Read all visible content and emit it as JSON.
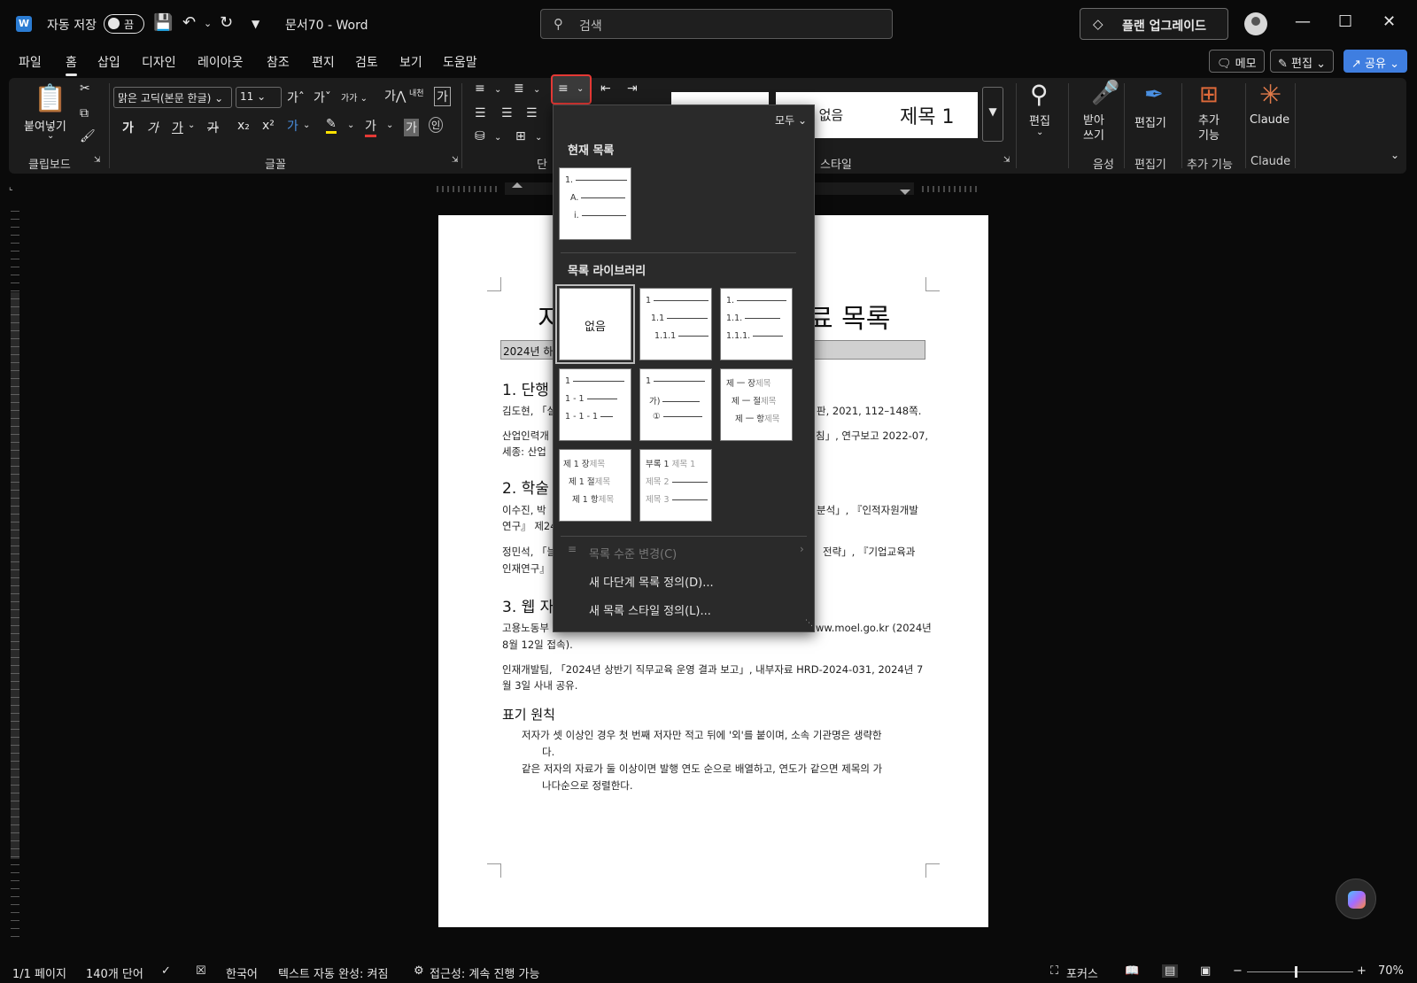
{
  "titlebar": {
    "autosave_label": "자동 저장",
    "autosave_state": "끔",
    "doc_title": "문서70  -  Word",
    "search_placeholder": "검색",
    "upgrade_label": "플랜 업그레이드"
  },
  "tabs": [
    "파일",
    "홈",
    "삽입",
    "디자인",
    "레이아웃",
    "참조",
    "편지",
    "검토",
    "보기",
    "도움말"
  ],
  "active_tab": "홈",
  "top_right": {
    "memo": "메모",
    "edit": "편집",
    "share": "공유"
  },
  "ribbon": {
    "paste_label": "붙여넣기",
    "clipboard_group": "클립보드",
    "font_name": "맑은 고딕(본문 한글)",
    "font_size": "11",
    "font_group": "글꼴",
    "paragraph_group_partial": "단",
    "styles_group_partial": "스타일",
    "style_nospacing_partial": "격 없음",
    "style_heading1": "제목 1",
    "editing_label": "편집",
    "dictate_label": "받아\n쓰기",
    "voice_group": "음성",
    "editor_label": "편집기",
    "editor_group": "편집기",
    "addins_label": "추가\n기능",
    "addins_group": "추가 기능",
    "claude_label": "Claude",
    "claude_group": "Claude",
    "font_buttons": [
      "가",
      "가",
      "가",
      "가",
      "x₂",
      "x²"
    ]
  },
  "multilevel_dropdown": {
    "filter_label": "모두",
    "current_list_heading": "현재 목록",
    "current_list_tile": [
      "1.",
      "A.",
      "i."
    ],
    "library_heading": "목록 라이브러리",
    "none_label": "없음",
    "tiles": [
      {
        "lines": [
          "1",
          "1.1",
          "1.1.1"
        ]
      },
      {
        "lines": [
          "1.",
          "1.1.",
          "1.1.1."
        ]
      },
      {
        "lines": [
          "1",
          "1 - 1",
          "1 - 1 - 1"
        ]
      },
      {
        "lines": [
          "1",
          "가)",
          "①"
        ]
      },
      {
        "lines": [
          "제 一 장",
          "제 一 절",
          "제 一 항"
        ],
        "suffix": "제목"
      },
      {
        "lines": [
          "제 1 장",
          "제 1 절",
          "제 1 항"
        ],
        "suffix": "제목"
      },
      {
        "lines": [
          "부록 1",
          "제목 2",
          "제목 3"
        ],
        "suffix": "제목 1"
      }
    ],
    "change_level": "목록 수준 변경(C)",
    "define_multilevel": "새 다단계 목록 정의(D)...",
    "define_style": "새 목록 스타일 정의(L)..."
  },
  "document": {
    "title_left": "지",
    "title_right": "료 목록",
    "subtitle_left": "2024년 하",
    "h1": "1. 단행",
    "p1": "김도현, 「실",
    "p1_end": "판, 2021, 112–148쪽.",
    "p2a": "산업인력개",
    "p2a_end": "침」, 연구보고 2022-07,",
    "p2b": "세종: 산업",
    "h2": "2. 학술",
    "p3a": "이수진, 박",
    "p3a_end": "분석」, 『인적자원개발",
    "p3b": "연구』 제24",
    "p4a": "정민석, 「늘",
    "p4a_end": "전략」, 『기업교육과",
    "p4b": "인재연구』",
    "h3": "3. 웹 자",
    "p5a": "고용노동부",
    "p5a_end": "ww.moel.go.kr (2024년",
    "p5b": "8월 12일 접속).",
    "p6a": "인재개발팀, 「2024년 상반기 직무교육 운영 결과 보고」, 내부자료 HRD-2024-031, 2024년 7",
    "p6b": "월 3일 사내 공유.",
    "h4": "표기 원칙",
    "r1a": "저자가 셋 이상인 경우 첫 번째 저자만 적고 뒤에 '외'를 붙이며, 소속 기관명은 생략한",
    "r1b": "다.",
    "r2a": "같은 저자의 자료가 둘 이상이면 발행 연도 순으로 배열하고, 연도가 같으면 제목의 가",
    "r2b": "나다순으로 정렬한다."
  },
  "status": {
    "page": "1/1 페이지",
    "words": "140개 단어",
    "language": "한국어",
    "autocomplete": "텍스트 자동 완성: 켜짐",
    "accessibility": "접근성: 계속 진행 가능",
    "focus": "포커스",
    "zoom": "70%"
  },
  "colors": {
    "accent_blue": "#3f7ee0",
    "highlight_red": "#e53935",
    "word_blue": "#2b7cd3"
  }
}
